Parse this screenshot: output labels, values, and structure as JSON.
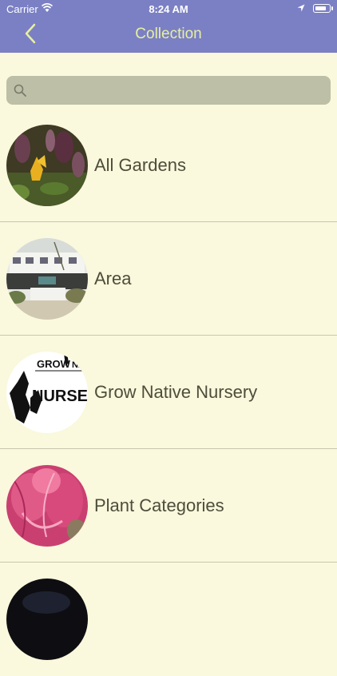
{
  "status_bar": {
    "carrier": "Carrier",
    "time": "8:24 AM"
  },
  "nav": {
    "title": "Collection",
    "back_icon": "chevron-left-icon"
  },
  "search": {
    "placeholder": "",
    "icon": "search-icon"
  },
  "items": [
    {
      "label": "All Gardens"
    },
    {
      "label": "Area"
    },
    {
      "label": "Grow Native Nursery"
    },
    {
      "label": "Plant Categories"
    },
    {
      "label": ""
    }
  ],
  "colors": {
    "header": "#7b80c4",
    "background": "#faf8dd",
    "title": "#e6f0a0",
    "search_bg": "#bdbfa6"
  }
}
